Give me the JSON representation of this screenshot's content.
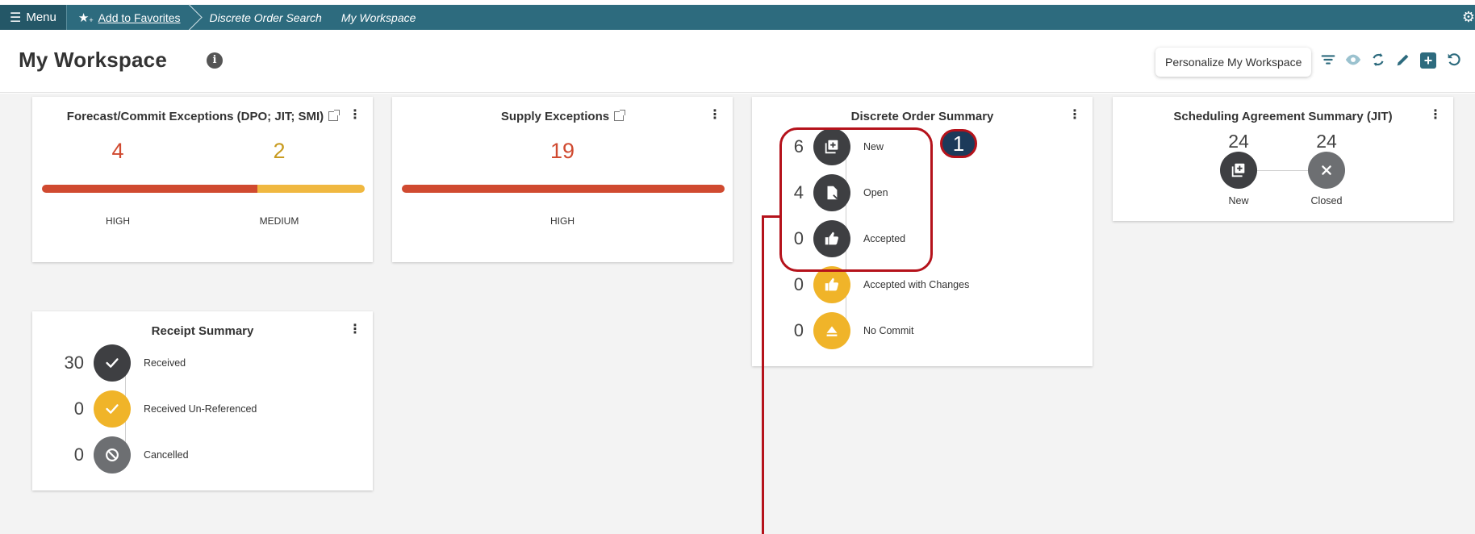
{
  "topbar": {
    "menu_label": "Menu",
    "favorites_label": "Add to Favorites",
    "breadcrumbs": [
      "Discrete Order Search",
      "My Workspace"
    ]
  },
  "header": {
    "title": "My Workspace",
    "personalize_label": "Personalize My Workspace"
  },
  "cards": {
    "forecast": {
      "title": "Forecast/Commit Exceptions (DPO; JIT; SMI)",
      "high_value": "4",
      "medium_value": "2",
      "high_label": "HIGH",
      "medium_label": "MEDIUM"
    },
    "supply": {
      "title": "Supply Exceptions",
      "high_value": "19",
      "high_label": "HIGH"
    },
    "discrete": {
      "title": "Discrete Order Summary",
      "rows": [
        {
          "count": "6",
          "label": "New"
        },
        {
          "count": "4",
          "label": "Open"
        },
        {
          "count": "0",
          "label": "Accepted"
        },
        {
          "count": "0",
          "label": "Accepted with Changes"
        },
        {
          "count": "0",
          "label": "No Commit"
        }
      ],
      "callout_number": "1"
    },
    "jit": {
      "title": "Scheduling Agreement Summary (JIT)",
      "new_count": "24",
      "closed_count": "24",
      "new_label": "New",
      "closed_label": "Closed"
    },
    "receipt": {
      "title": "Receipt Summary",
      "rows": [
        {
          "count": "30",
          "label": "Received"
        },
        {
          "count": "0",
          "label": "Received Un-Referenced"
        },
        {
          "count": "0",
          "label": "Cancelled"
        }
      ]
    }
  },
  "colors": {
    "topbar": "#2d6b7e",
    "high": "#d04a30",
    "medium": "#f0b840",
    "dark_circle": "#3e3f42",
    "gold_circle": "#f0b429",
    "highlight": "#b5121b"
  }
}
